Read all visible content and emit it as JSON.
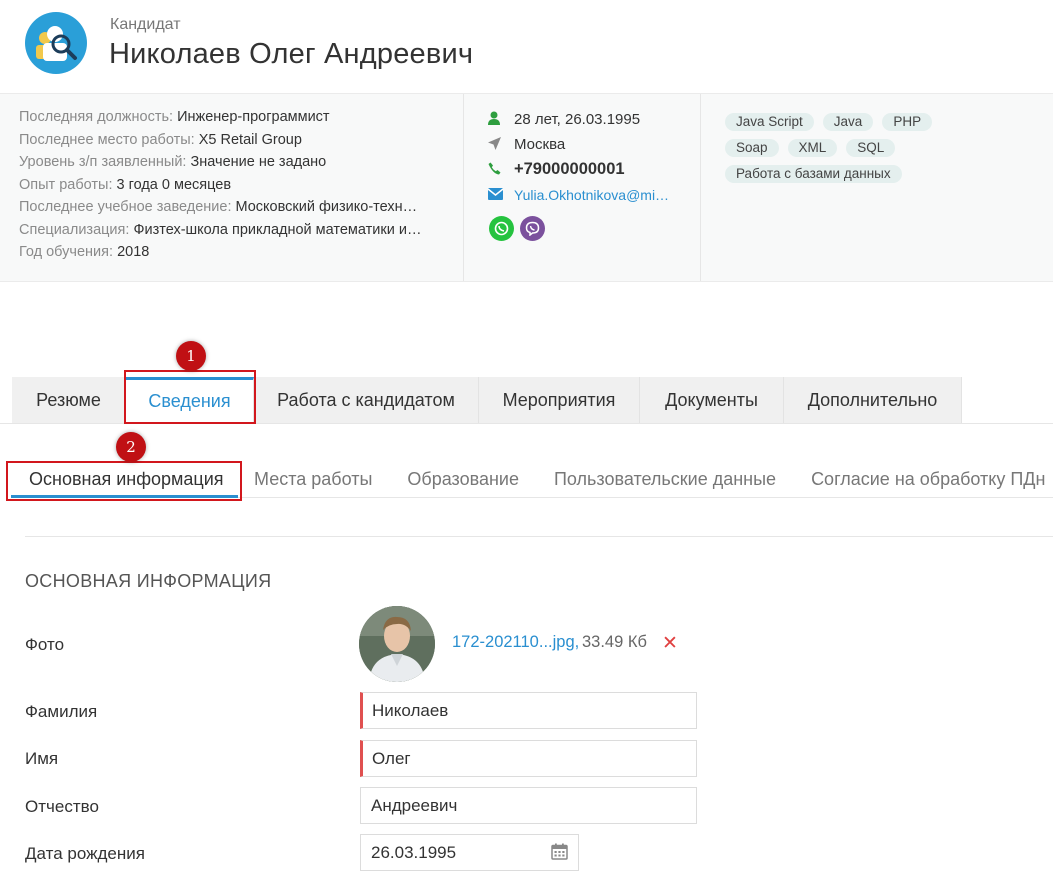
{
  "header": {
    "label": "Кандидат",
    "name": "Николаев Олег Андреевич",
    "logo_icon": "candidate-search-icon"
  },
  "info": {
    "rows": [
      {
        "key": "Последняя должность:",
        "value": "Инженер-программист"
      },
      {
        "key": "Последнее место работы:",
        "value": "X5 Retail Group"
      },
      {
        "key": "Уровень з/п заявленный:",
        "value": "Значение не задано"
      },
      {
        "key": "Опыт работы:",
        "value": "3 года 0 месяцев"
      },
      {
        "key": "Последнее учебное заведение:",
        "value": "Московский физико-техн…"
      },
      {
        "key": "Специализация:",
        "value": "Физтех-школа прикладной математики и…"
      },
      {
        "key": "Год обучения:",
        "value": "2018"
      }
    ]
  },
  "contacts": {
    "age": "28 лет, 26.03.1995",
    "city": "Москва",
    "phone": "+79000000001",
    "email": "Yulia.Okhotnikova@mi…",
    "messengers": [
      "whatsapp-icon",
      "viber-icon"
    ]
  },
  "skills": [
    "Java Script",
    "Java",
    "PHP",
    "Soap",
    "XML",
    "SQL",
    "Работа с базами данных"
  ],
  "main_tabs": [
    {
      "label": "Резюме"
    },
    {
      "label": "Сведения"
    },
    {
      "label": "Работа с кандидатом"
    },
    {
      "label": "Мероприятия"
    },
    {
      "label": "Документы"
    },
    {
      "label": "Дополнительно"
    }
  ],
  "sub_tabs": [
    {
      "label": "Основная информация"
    },
    {
      "label": "Места работы"
    },
    {
      "label": "Образование"
    },
    {
      "label": "Пользовательские данные"
    },
    {
      "label": "Согласие на обработку ПДн"
    }
  ],
  "markers": [
    "1",
    "2"
  ],
  "section": {
    "title": "ОСНОВНАЯ ИНФОРМАЦИЯ",
    "photo_label": "Фото",
    "photo_file": "172-202110...jpg,",
    "photo_size": "33.49 Кб",
    "delete_symbol": "✕",
    "fields": [
      {
        "label": "Фамилия",
        "value": "Николаев"
      },
      {
        "label": "Имя",
        "value": "Олег"
      },
      {
        "label": "Отчество",
        "value": "Андреевич"
      },
      {
        "label": "Дата рождения",
        "value": "26.03.1995"
      }
    ]
  },
  "colors": {
    "accent": "#2a8fd0",
    "highlight": "#d2171d",
    "required": "#e05050",
    "whatsapp": "#25c33f",
    "viber": "#7b519d"
  }
}
